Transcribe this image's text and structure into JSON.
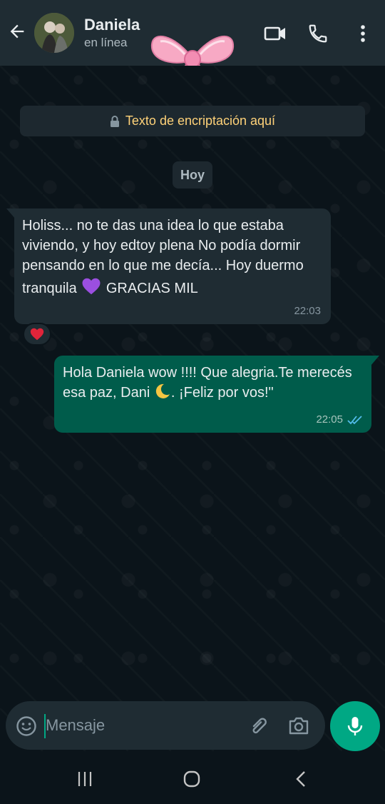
{
  "header": {
    "contact_name": "Daniela",
    "status": "en línea"
  },
  "chat": {
    "encryption_notice": "Texto de encriptación aquí",
    "date_chip": "Hoy",
    "messages": [
      {
        "direction": "incoming",
        "text_part1": "Holiss... no te das una idea lo que estaba viviendo, y hoy edtoy plena No podía dormir pensando en lo que me decía... Hoy duermo tranquila",
        "text_part2": "GRACIAS MIL",
        "inline_emoji": "purple-heart-icon",
        "time": "22:03",
        "reaction": "red-heart-icon"
      },
      {
        "direction": "outgoing",
        "text_part1": "Hola Daniela wow !!!! Que alegria.Te merecés esa paz, Dani",
        "text_part2": ". ¡Feliz por vos!\"",
        "inline_emoji": "crescent-moon-icon",
        "time": "22:05",
        "status": "read"
      }
    ]
  },
  "composer": {
    "placeholder": "Mensaje"
  },
  "colors": {
    "header_bg": "#1f2c33",
    "chat_bg": "#0b141a",
    "incoming_bubble": "#1f2c33",
    "outgoing_bubble": "#005c4b",
    "accent": "#00a884",
    "encryption_text": "#ffd279",
    "read_ticks": "#53bdeb"
  }
}
